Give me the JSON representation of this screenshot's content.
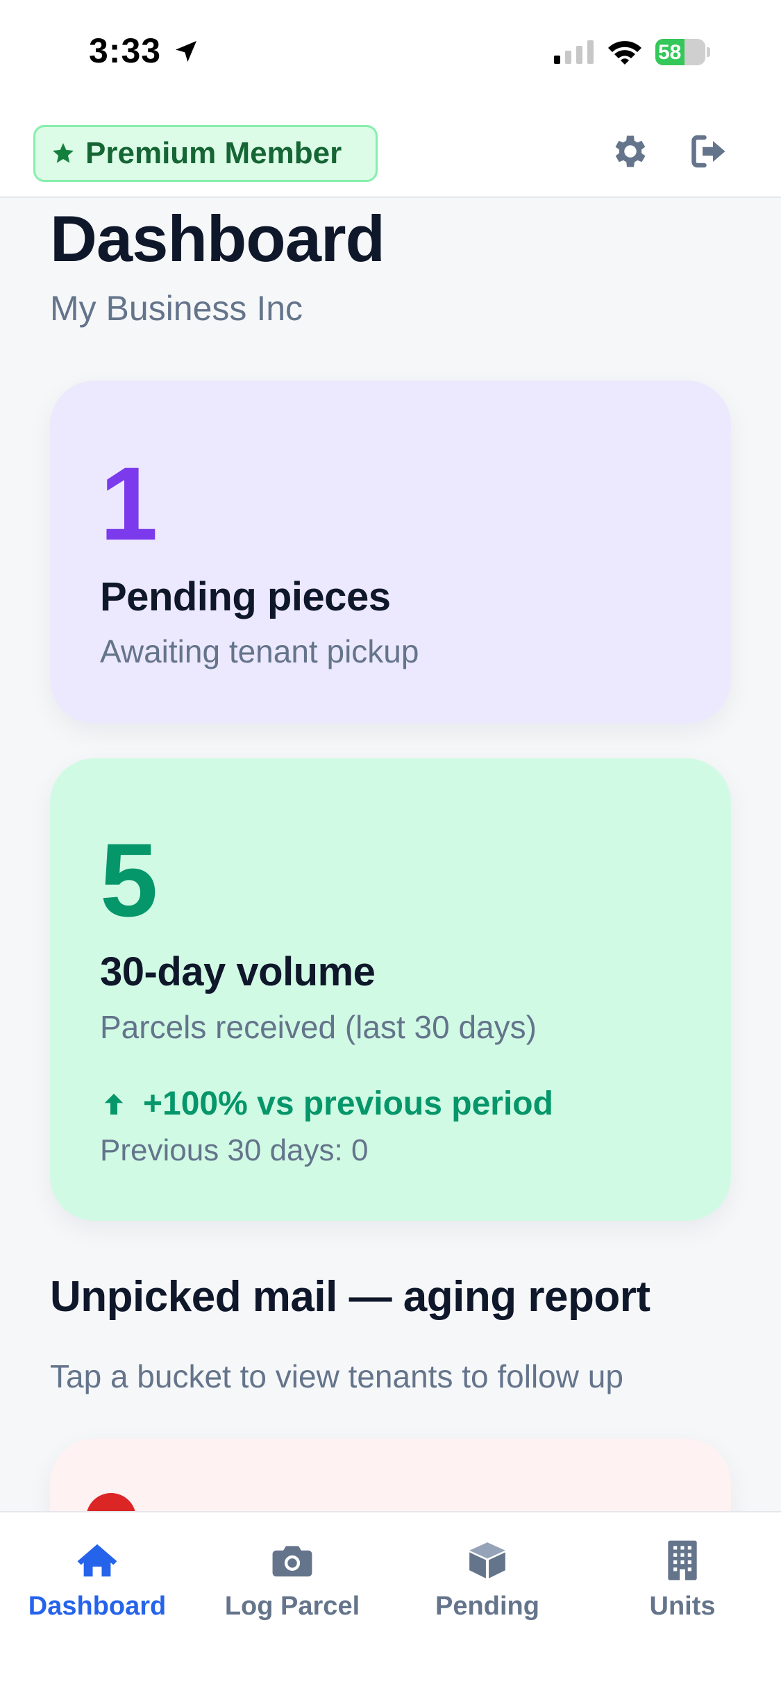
{
  "status_bar": {
    "time": "3:33",
    "battery": "58",
    "battery_level": 0.58
  },
  "header": {
    "badge_label": "Premium Member",
    "badge_icon": "star-icon",
    "settings_icon": "gear-icon",
    "logout_icon": "sign-out-icon"
  },
  "page": {
    "title": "Dashboard",
    "subtitle": "My Business Inc"
  },
  "pending_card": {
    "value": "1",
    "title": "Pending pieces",
    "description": "Awaiting tenant pickup"
  },
  "volume_card": {
    "value": "5",
    "title": "30-day volume",
    "description": "Parcels received (last 30 days)",
    "trend": "+100% vs previous period",
    "previous": "Previous 30 days: 0"
  },
  "aging": {
    "title": "Unpicked mail — aging report",
    "subtitle": "Tap a bucket to view tenants to follow up"
  },
  "tabs": [
    {
      "label": "Dashboard",
      "icon": "home-icon",
      "active": true
    },
    {
      "label": "Log Parcel",
      "icon": "camera-icon",
      "active": false
    },
    {
      "label": "Pending",
      "icon": "box-icon",
      "active": false
    },
    {
      "label": "Units",
      "icon": "building-icon",
      "active": false
    }
  ],
  "colors": {
    "accent": "#2563eb",
    "purple": "#7c3aed",
    "green": "#059669",
    "premium_green": "#166534"
  }
}
